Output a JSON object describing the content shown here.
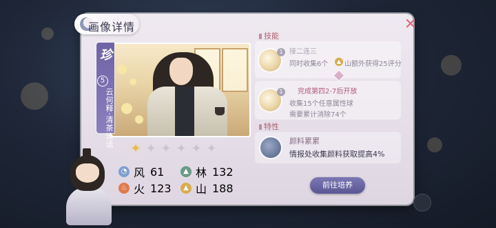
{
  "header": {
    "title": "画像详情"
  },
  "card": {
    "rarity": "珍",
    "level": "5",
    "name_vertical": "云何释·清茶淡话",
    "stars_on": 1,
    "stars_total": 6
  },
  "stats": [
    {
      "label": "风",
      "value": "61",
      "icon": "wind-icon",
      "color": "#7f9fd2"
    },
    {
      "label": "林",
      "value": "132",
      "icon": "forest-icon",
      "color": "#6a9a86"
    },
    {
      "label": "火",
      "value": "123",
      "icon": "fire-icon",
      "color": "#e07a4a"
    },
    {
      "label": "山",
      "value": "188",
      "icon": "mountain-icon",
      "color": "#d9ad4d"
    }
  ],
  "skills": {
    "section_label": "技能",
    "skill1": {
      "badge": "1",
      "title": "接二连三",
      "line1": "同时收集6个",
      "line1b": "山额外获得25评分"
    },
    "skill2": {
      "badge": "1",
      "unlock": "完成第四2-7后开放",
      "line1": "收集15个任意属性球",
      "line2": "需要累计消除74个"
    }
  },
  "traits": {
    "section_label": "特性",
    "name": "颜料累累",
    "desc": "情报处收集颜料获取提高4%"
  },
  "actions": {
    "go_button": "前往培养"
  },
  "colors": {
    "accent": "#5a5694",
    "panel": "#ece6ee",
    "rarity": "#6f63a6"
  }
}
